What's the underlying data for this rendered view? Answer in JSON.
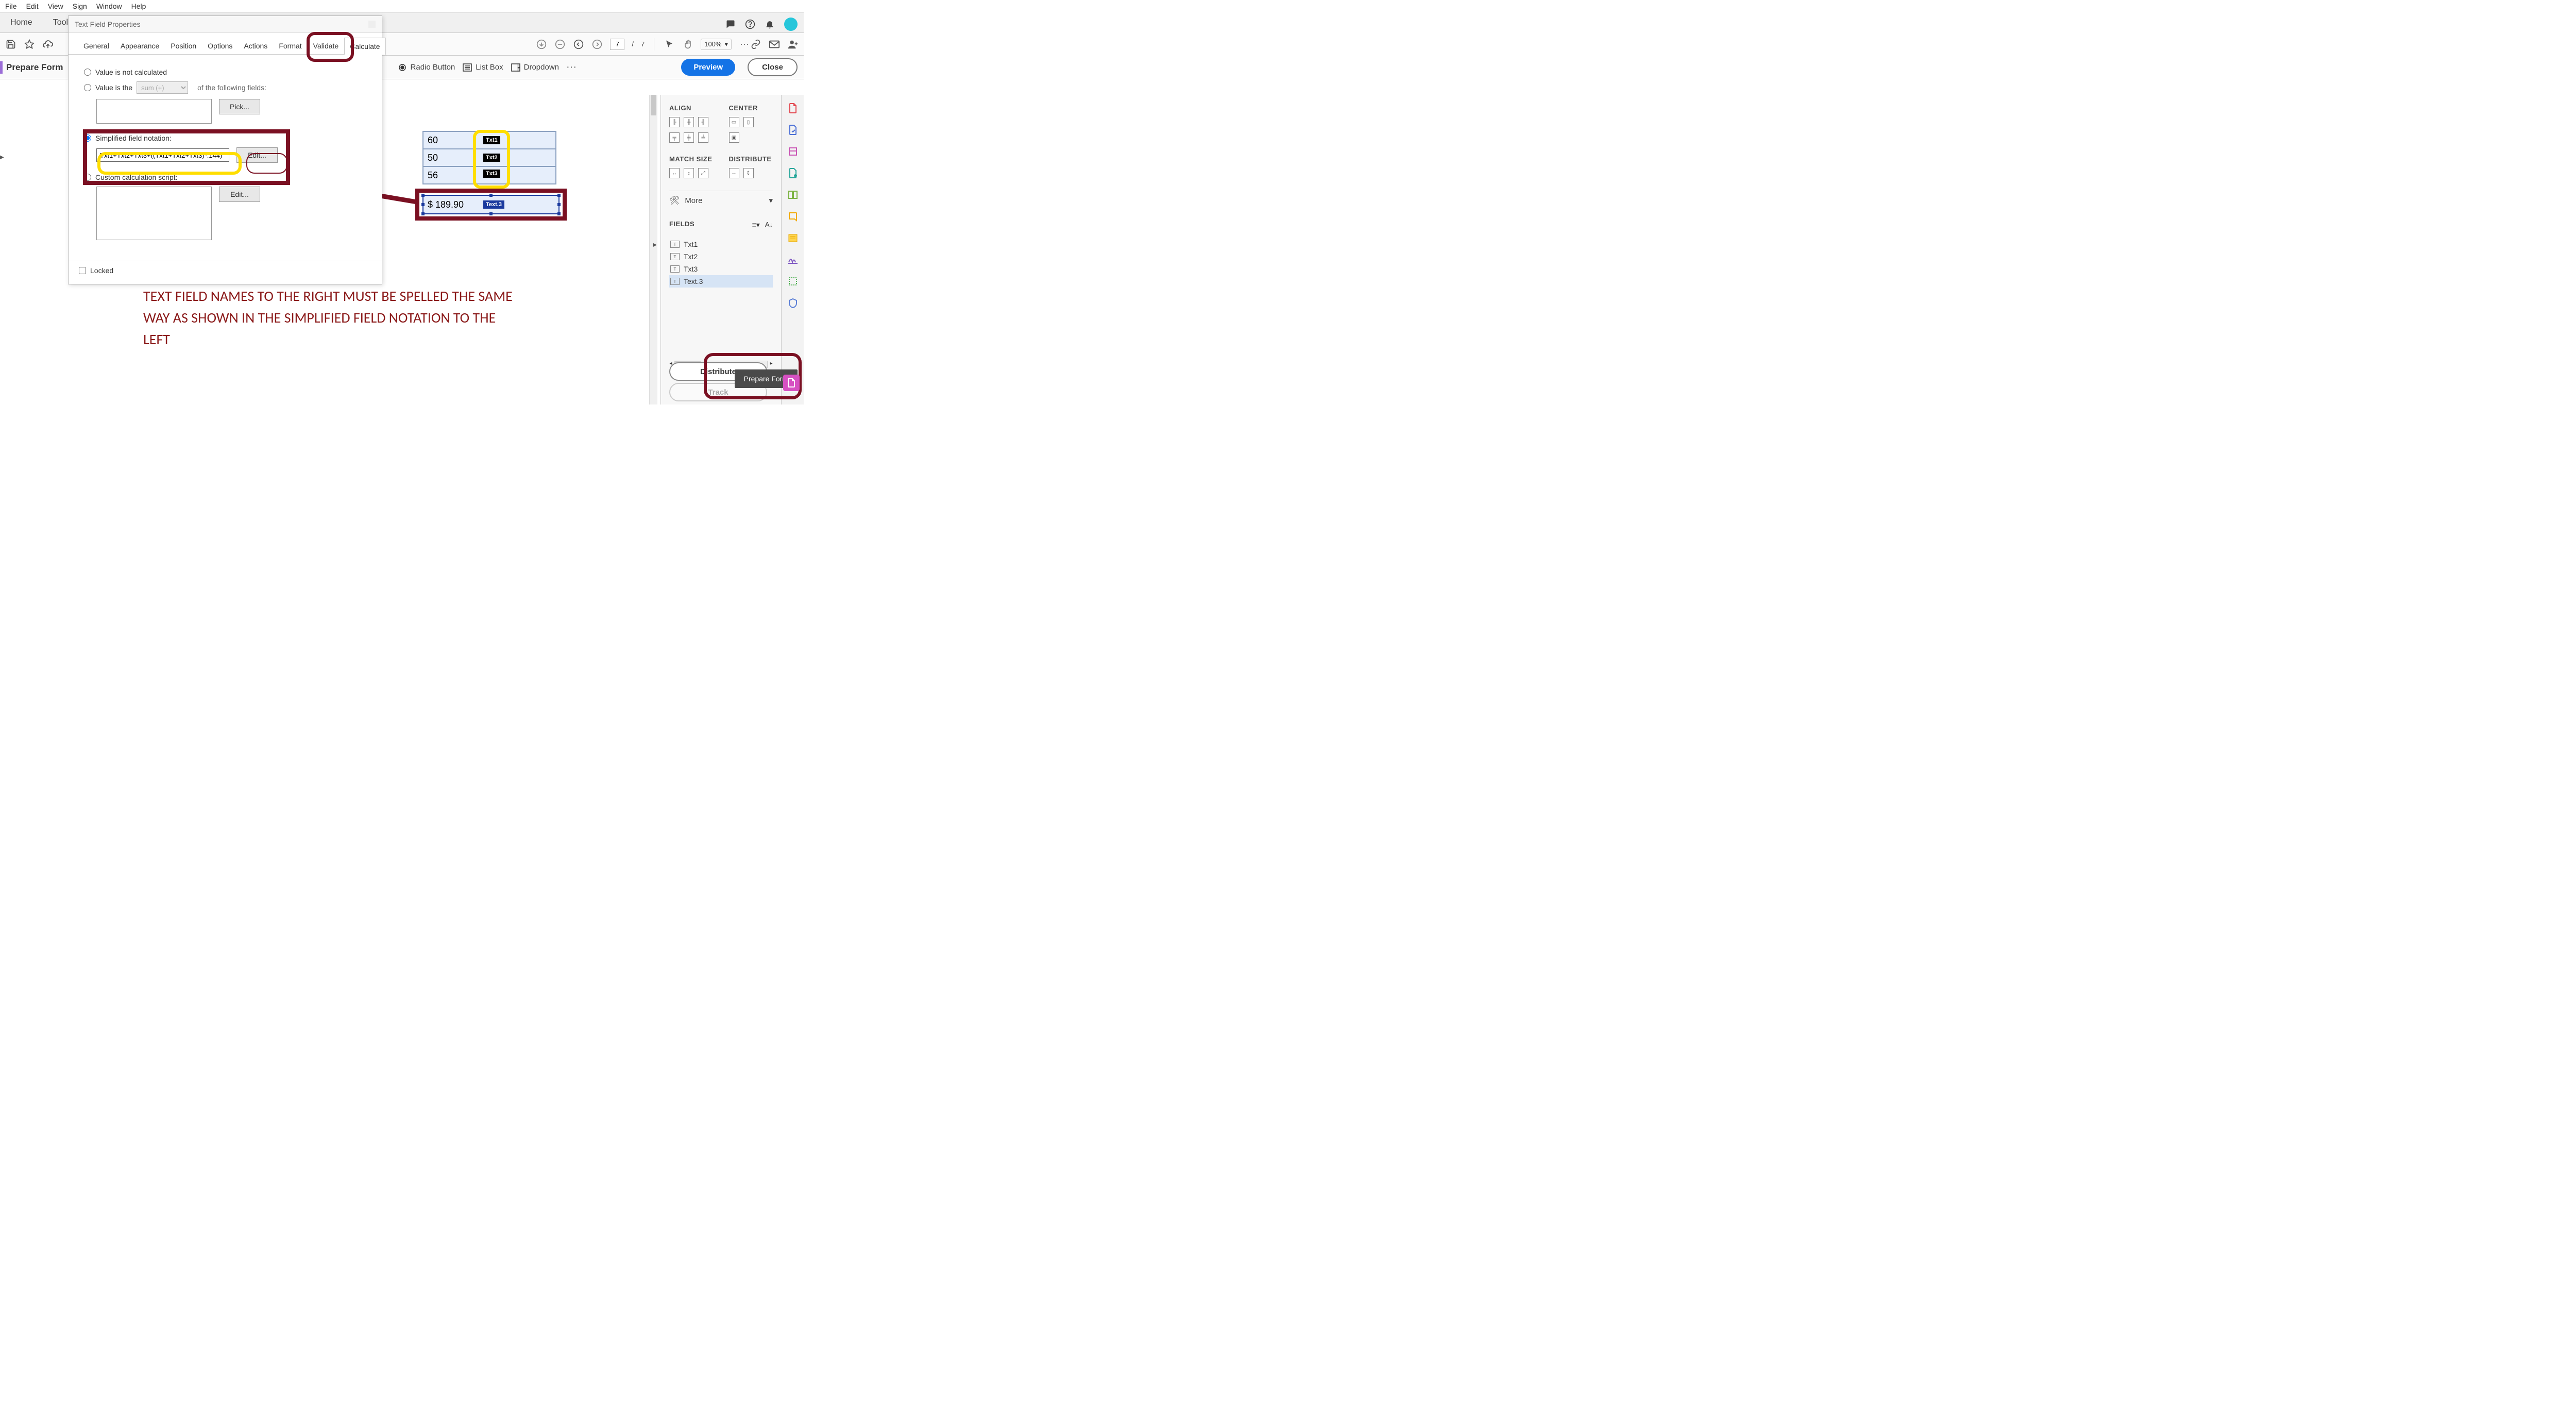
{
  "menu": {
    "file": "File",
    "edit": "Edit",
    "view": "View",
    "sign": "Sign",
    "window": "Window",
    "help": "Help"
  },
  "home_tools": {
    "home": "Home",
    "tools": "Tools"
  },
  "toolbar": {
    "page_current": "7",
    "page_sep": "/",
    "page_total": "7",
    "zoom": "100%"
  },
  "prepbar": {
    "title": "Prepare Form",
    "radio": "Radio Button",
    "listbox": "List Box",
    "dropdown": "Dropdown",
    "more": "···",
    "preview": "Preview",
    "close": "Close"
  },
  "dialog": {
    "title": "Text Field Properties",
    "tabs": {
      "general": "General",
      "appearance": "Appearance",
      "position": "Position",
      "options": "Options",
      "actions": "Actions",
      "format": "Format",
      "validate": "Validate",
      "calculate": "Calculate"
    },
    "r1": "Value is not calculated",
    "r2": "Value is the",
    "r2_op": "sum (+)",
    "r2_follow": "of the following fields:",
    "pick": "Pick...",
    "r3": "Simplified field notation:",
    "sf_value": "Txt1+Txt2+Txt3+((Txt1+Txt2+Txt3)*.144)",
    "edit": "Edit...",
    "r4": "Custom calculation script:",
    "locked": "Locked"
  },
  "fields": {
    "row1": {
      "value": "60",
      "tag": "Txt1"
    },
    "row2": {
      "value": "50",
      "tag": "Txt2"
    },
    "row3": {
      "value": "56",
      "tag": "Txt3"
    },
    "result": {
      "value": "$ 189.90",
      "tag": "Text.3"
    }
  },
  "annotation": "TEXT FIELD NAMES TO THE RIGHT MUST BE SPELLED THE SAME WAY AS SHOWN IN THE SIMPLIFIED FIELD NOTATION TO THE LEFT",
  "rpanel": {
    "align": "ALIGN",
    "center": "CENTER",
    "match": "MATCH SIZE",
    "distribute": "DISTRIBUTE",
    "more": "More",
    "fields_h": "FIELDS",
    "f1": "Txt1",
    "f2": "Txt2",
    "f3": "Txt3",
    "f4": "Text.3",
    "dist_btn": "Distribute",
    "track_btn": "Track"
  },
  "tooltip": "Prepare Form"
}
